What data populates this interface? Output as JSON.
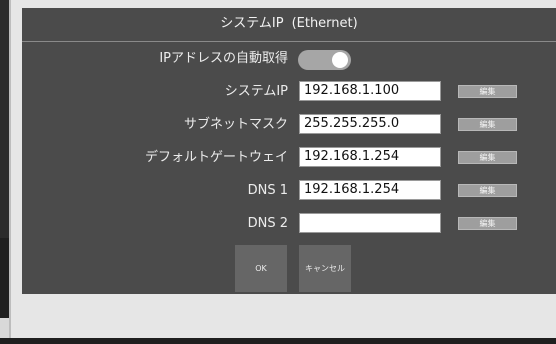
{
  "dialog": {
    "title": "システムIP",
    "subtitle": "(Ethernet)"
  },
  "auto_ip": {
    "label": "IPアドレスの自動取得",
    "enabled": true
  },
  "fields": [
    {
      "label": "システムIP",
      "value": "192.168.1.100",
      "edit_label": "編集"
    },
    {
      "label": "サブネットマスク",
      "value": "255.255.255.0",
      "edit_label": "編集"
    },
    {
      "label": "デフォルトゲートウェイ",
      "value": "192.168.1.254",
      "edit_label": "編集"
    },
    {
      "label": "DNS 1",
      "value": "192.168.1.254",
      "edit_label": "編集"
    },
    {
      "label": "DNS 2",
      "value": "",
      "edit_label": "編集"
    }
  ],
  "buttons": {
    "ok": "OK",
    "cancel": "キャンセル"
  },
  "colors": {
    "dialog_bg": "#4b4b4b",
    "toggle_track": "#a6a6a6",
    "button_bg": "#666666"
  }
}
